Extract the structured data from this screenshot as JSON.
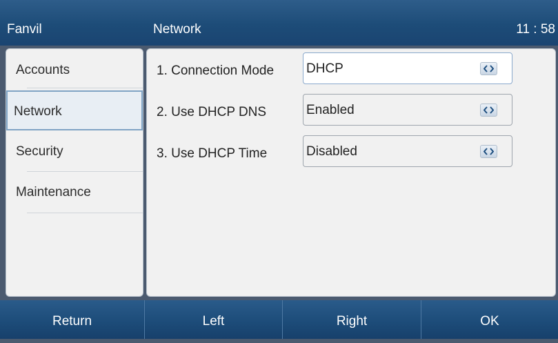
{
  "titlebar": {
    "brand": "Fanvil",
    "page": "Network",
    "clock": "11 : 58"
  },
  "sidebar": {
    "items": [
      {
        "label": "Accounts"
      },
      {
        "label": "Network"
      },
      {
        "label": "Security"
      },
      {
        "label": "Maintenance"
      }
    ],
    "selected": "Network"
  },
  "settings": {
    "rows": [
      {
        "label": "1. Connection Mode",
        "value": "DHCP"
      },
      {
        "label": "2. Use DHCP DNS",
        "value": "Enabled"
      },
      {
        "label": "3. Use DHCP Time",
        "value": "Disabled"
      }
    ]
  },
  "softkeys": {
    "return_label": "Return",
    "left_label": "Left",
    "right_label": "Right",
    "ok_label": "OK"
  },
  "colors": {
    "accent": "#1d4c78",
    "panel": "#f1f1f1",
    "selected_border": "#7fa3c4"
  },
  "icons": [
    "left-right-arrows-icon"
  ]
}
